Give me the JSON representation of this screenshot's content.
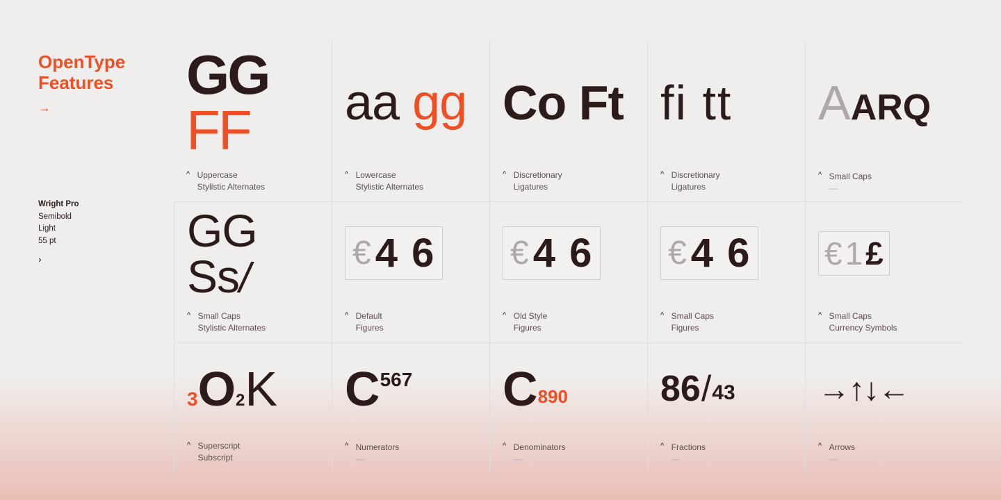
{
  "sidebar": {
    "title": "OpenType\nFeatures",
    "arrow": "→",
    "font_info": {
      "name": "Wright Pro",
      "weight": "Semibold",
      "style": "Light",
      "size": "55 pt"
    },
    "arrow_small": "›"
  },
  "grid": {
    "row1": [
      {
        "display": "GG FF",
        "label1": "Uppercase",
        "label2": "Stylistic Alternates"
      },
      {
        "display": "aa gg",
        "label1": "Lowercase",
        "label2": "Stylistic Alternates"
      },
      {
        "display": "Co Ft",
        "label1": "Discretionary",
        "label2": "Ligatures"
      },
      {
        "display": "fi tt",
        "label1": "Discretionary",
        "label2": "Ligatures"
      },
      {
        "display": "A ARQ",
        "label1": "Small Caps",
        "label2": "—"
      }
    ],
    "row2": [
      {
        "display": "GG Ss",
        "label1": "Small Caps",
        "label2": "Stylistic Alternates"
      },
      {
        "display": "€ 4 6",
        "label1": "Default",
        "label2": "Figures"
      },
      {
        "display": "€ 4 6",
        "label1": "Old Style",
        "label2": "Figures"
      },
      {
        "display": "€ 4 6",
        "label1": "Small Caps",
        "label2": "Figures"
      },
      {
        "display": "€ 1 £",
        "label1": "Small Caps",
        "label2": "Currency Symbols"
      }
    ],
    "row3": [
      {
        "display": "³O₂K",
        "label1": "Superscript",
        "label2": "Subscript"
      },
      {
        "display": "C⁵⁶⁷",
        "label1": "Numerators",
        "label2": "—"
      },
      {
        "display": "C₈₉₀",
        "label1": "Denominators",
        "label2": "—"
      },
      {
        "display": "⁸⁶/₄₃",
        "label1": "Fractions",
        "label2": "—"
      },
      {
        "display": "→↑↓←",
        "label1": "Arrows",
        "label2": "—"
      }
    ]
  }
}
